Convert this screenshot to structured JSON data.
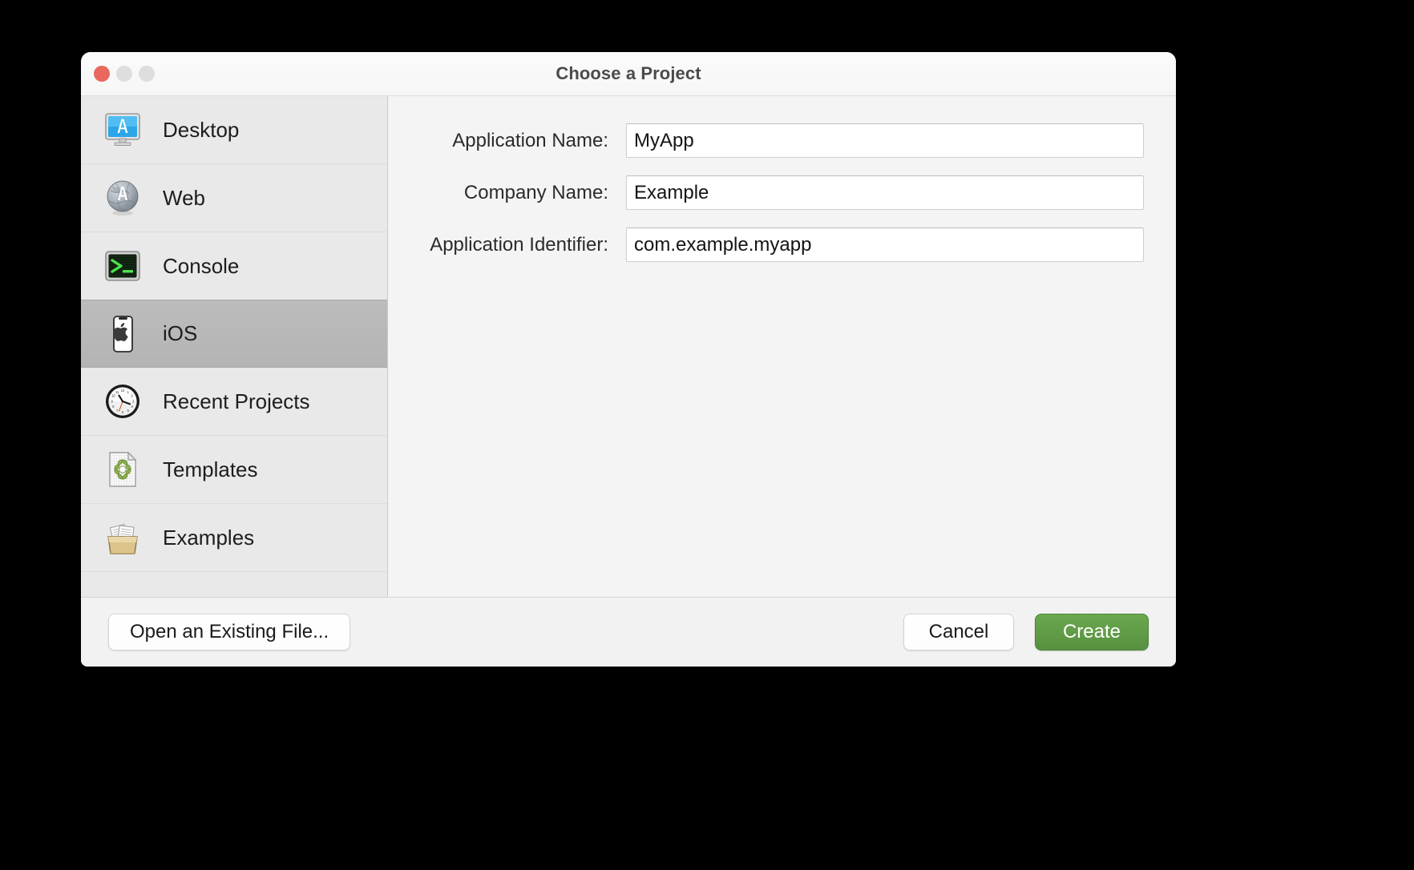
{
  "window": {
    "title": "Choose a Project",
    "traffic_lights": [
      {
        "name": "close",
        "color": "#e9685e"
      },
      {
        "name": "minimize",
        "color": "#dedede"
      },
      {
        "name": "zoom",
        "color": "#dedede"
      }
    ]
  },
  "sidebar": {
    "items": [
      {
        "label": "Desktop",
        "icon": "desktop-app-icon",
        "selected": false
      },
      {
        "label": "Web",
        "icon": "web-globe-icon",
        "selected": false
      },
      {
        "label": "Console",
        "icon": "console-terminal-icon",
        "selected": false
      },
      {
        "label": "iOS",
        "icon": "ios-phone-icon",
        "selected": true
      },
      {
        "label": "Recent Projects",
        "icon": "clock-icon",
        "selected": false
      },
      {
        "label": "Templates",
        "icon": "template-document-icon",
        "selected": false
      },
      {
        "label": "Examples",
        "icon": "examples-folder-icon",
        "selected": false
      }
    ]
  },
  "form": {
    "fields": [
      {
        "label": "Application Name:",
        "value": "MyApp",
        "placeholder": ""
      },
      {
        "label": "Company Name:",
        "value": "Example",
        "placeholder": ""
      },
      {
        "label": "Application Identifier:",
        "value": "com.example.myapp",
        "placeholder": ""
      }
    ]
  },
  "footer": {
    "open_existing_label": "Open an Existing File...",
    "cancel_label": "Cancel",
    "create_label": "Create",
    "create_color": "#5f9c46"
  }
}
